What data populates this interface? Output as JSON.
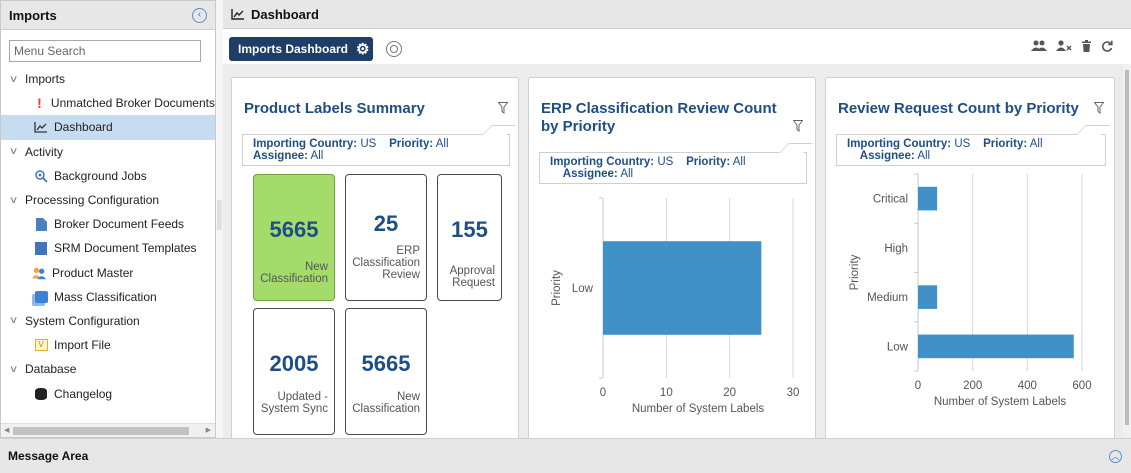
{
  "sidebar": {
    "title": "Imports",
    "search_placeholder": "Menu Search",
    "groups": [
      {
        "label": "Imports",
        "items": [
          {
            "label": "Unmatched Broker Documents",
            "icon": "exclamation-icon"
          },
          {
            "label": "Dashboard",
            "icon": "chart-line-icon",
            "selected": true
          }
        ]
      },
      {
        "label": "Activity",
        "items": [
          {
            "label": "Background Jobs",
            "icon": "search-gear-icon"
          }
        ]
      },
      {
        "label": "Processing Configuration",
        "items": [
          {
            "label": "Broker Document Feeds",
            "icon": "document-icon"
          },
          {
            "label": "SRM Document Templates",
            "icon": "template-icon"
          },
          {
            "label": "Product Master",
            "icon": "users-icon"
          },
          {
            "label": "Mass Classification",
            "icon": "stack-icon"
          }
        ]
      },
      {
        "label": "System Configuration",
        "items": [
          {
            "label": "Import File",
            "icon": "file-icon"
          }
        ]
      },
      {
        "label": "Database",
        "items": [
          {
            "label": "Changelog",
            "icon": "database-icon"
          }
        ]
      }
    ]
  },
  "main": {
    "title": "Dashboard",
    "dashboard_button": "Imports Dashboard"
  },
  "filters": {
    "country_label": "Importing Country:",
    "country_value": "US",
    "priority_label": "Priority:",
    "priority_value": "All",
    "assignee_label": "Assignee:",
    "assignee_value": "All"
  },
  "cards": {
    "product_labels": {
      "title": "Product Labels Summary",
      "tiles": [
        {
          "value": "5665",
          "label": "New Classification",
          "highlight": true
        },
        {
          "value": "25",
          "label": "ERP Classification Review",
          "highlight": false
        },
        {
          "value": "155",
          "label": "Approval Request",
          "highlight": false
        },
        {
          "value": "2005",
          "label": "Updated - System Sync",
          "highlight": false
        },
        {
          "value": "5665",
          "label": "New Classification",
          "highlight": false
        }
      ]
    },
    "erp_review": {
      "title_line1": "ERP Classification Review Count",
      "title_line2": "by Priority"
    },
    "review_request": {
      "title": "Review Request Count by Priority"
    }
  },
  "chart_data": [
    {
      "type": "bar",
      "orientation": "horizontal",
      "title": "ERP Classification Review Count by Priority",
      "categories": [
        "Low"
      ],
      "values": [
        25
      ],
      "xlabel": "Number of System Labels",
      "ylabel": "Priority",
      "xlim": [
        0,
        30
      ],
      "xticks": [
        "0",
        "10",
        "20",
        "30"
      ],
      "grid": true,
      "color": "#4191c9"
    },
    {
      "type": "bar",
      "orientation": "horizontal",
      "title": "Review Request Count by Priority",
      "categories": [
        "Critical",
        "High",
        "Medium",
        "Low"
      ],
      "values": [
        70,
        0,
        70,
        570
      ],
      "xlabel": "Number of System Labels",
      "ylabel": "Priority",
      "xlim": [
        0,
        600
      ],
      "xticks": [
        "0",
        "200",
        "400",
        "600"
      ],
      "grid": true,
      "color": "#4191c9"
    }
  ],
  "message_area": {
    "title": "Message Area"
  }
}
